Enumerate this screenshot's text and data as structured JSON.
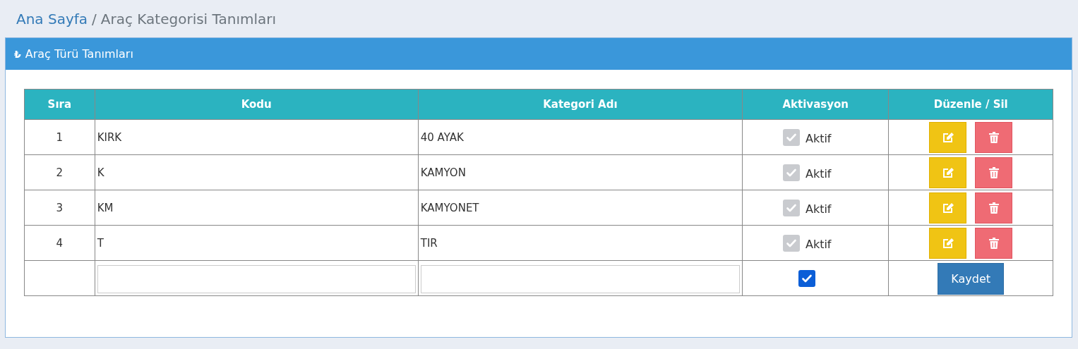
{
  "breadcrumb": {
    "home": "Ana Sayfa",
    "separator": "/",
    "current": "Araç Kategorisi Tanımları"
  },
  "panel": {
    "icon": "₺",
    "title": "Araç Türü Tanımları"
  },
  "table": {
    "columns": [
      "Sıra",
      "Kodu",
      "Kategori Adı",
      "Aktivasyon",
      "Düzenle / Sil"
    ],
    "rows": [
      {
        "index": "1",
        "code": "KIRK",
        "name": "40 AYAK",
        "checked": true,
        "disabled": true,
        "status": "Aktif"
      },
      {
        "index": "2",
        "code": "K",
        "name": "KAMYON",
        "checked": true,
        "disabled": true,
        "status": "Aktif"
      },
      {
        "index": "3",
        "code": "KM",
        "name": "KAMYONET",
        "checked": true,
        "disabled": true,
        "status": "Aktif"
      },
      {
        "index": "4",
        "code": "T",
        "name": "TIR",
        "checked": true,
        "disabled": true,
        "status": "Aktif"
      }
    ],
    "new_row": {
      "checked": true,
      "disabled": false,
      "save_button": "Kaydet"
    }
  }
}
